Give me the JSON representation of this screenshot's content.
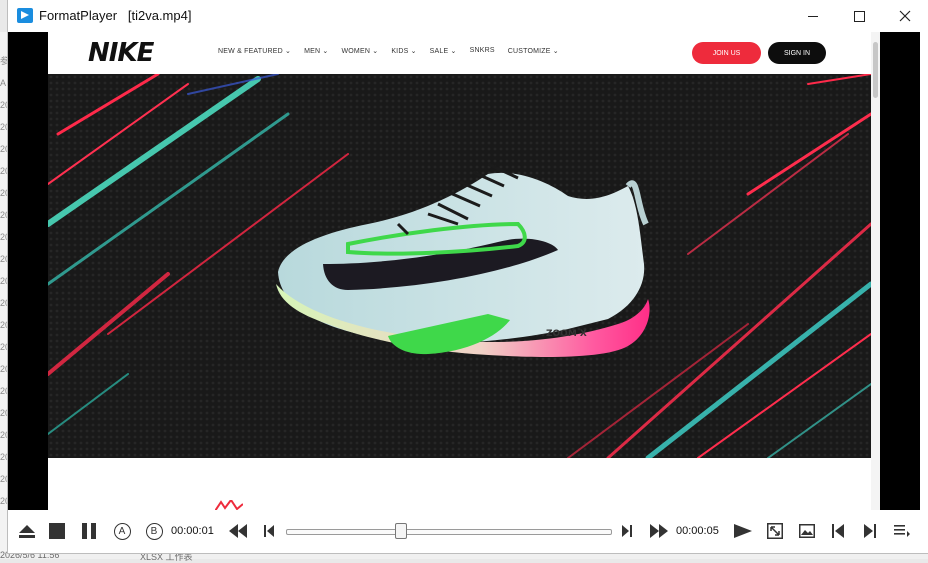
{
  "window": {
    "app_name": "FormatPlayer",
    "file_name": "[ti2va.mp4]"
  },
  "background_app": {
    "left_column_chars": [
      "参",
      "A",
      "20",
      "20",
      "20",
      "20",
      "20",
      "20",
      "20",
      "20",
      "20",
      "20",
      "20",
      "20",
      "20",
      "20",
      "20",
      "20",
      "20",
      "20",
      "20"
    ],
    "bottom_text_left": "2026/5/6 11:56",
    "bottom_text_right": "XLSX 工作表"
  },
  "website": {
    "logo": "NIKE",
    "nav_items": [
      "NEW & FEATURED ⌄",
      "MEN ⌄",
      "WOMEN ⌄",
      "KIDS ⌄",
      "SALE ⌄",
      "SNKRS",
      "CUSTOMIZE ⌄"
    ],
    "join_button": "JOIN US",
    "sign_in_button": "SIGN IN",
    "shoe_text": "ZOOM X"
  },
  "playback": {
    "current_time": "00:00:01",
    "total_time": "00:00:05",
    "progress_fraction": 0.35,
    "ab_a_label": "A",
    "ab_b_label": "B"
  },
  "colors": {
    "accent": "#1a8ddf",
    "nike_red": "#ee2b3c",
    "shoe_green": "#3fd84a",
    "shoe_pink": "#ff2e87"
  }
}
